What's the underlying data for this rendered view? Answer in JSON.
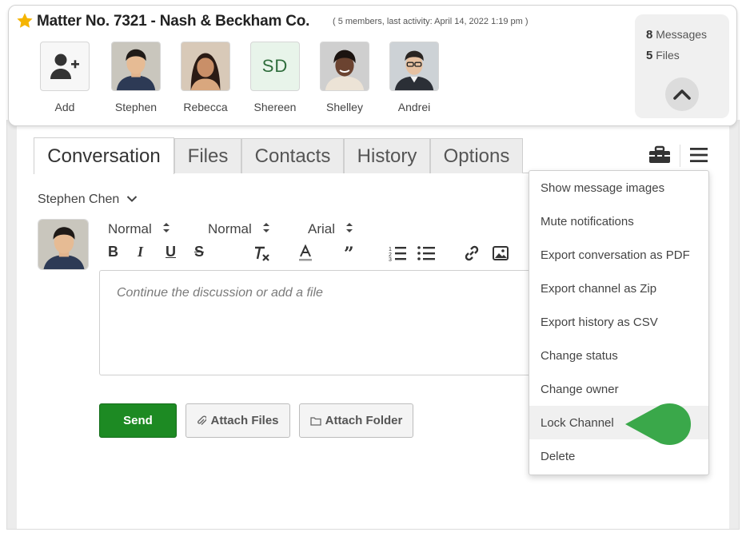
{
  "header": {
    "title": "Matter No. 7321 - Nash & Beckham Co.",
    "subtitle": "( 5 members, last activity: April 14, 2022 1:19 pm )",
    "members": [
      {
        "name": "Add",
        "kind": "add",
        "icon": "add-user-icon"
      },
      {
        "name": "Stephen",
        "kind": "photo"
      },
      {
        "name": "Rebecca",
        "kind": "photo"
      },
      {
        "name": "Shereen",
        "kind": "initials",
        "initials": "SD"
      },
      {
        "name": "Shelley",
        "kind": "photo"
      },
      {
        "name": "Andrei",
        "kind": "photo"
      }
    ],
    "stats": {
      "messages_count": "8",
      "messages_label": "Messages",
      "files_count": "5",
      "files_label": "Files"
    }
  },
  "tabs": [
    {
      "label": "Conversation",
      "active": true
    },
    {
      "label": "Files",
      "active": false
    },
    {
      "label": "Contacts",
      "active": false
    },
    {
      "label": "History",
      "active": false
    },
    {
      "label": "Options",
      "active": false
    }
  ],
  "composer": {
    "author": "Stephen Chen",
    "format": {
      "style": "Normal",
      "size": "Normal",
      "font": "Arial"
    },
    "placeholder": "Continue the discussion or add a file",
    "send_label": "Send",
    "attach_files_label": "Attach Files",
    "attach_folder_label": "Attach Folder"
  },
  "menu": {
    "items": [
      "Show message images",
      "Mute notifications",
      "Export conversation as PDF",
      "Export channel as Zip",
      "Export history as CSV",
      "Change status",
      "Change owner",
      "Lock Channel",
      "Delete"
    ],
    "highlighted": "Lock Channel"
  },
  "colors": {
    "accent_green": "#1d8a23",
    "pointer_green": "#3aa84a",
    "star": "#f5b400",
    "initials_bg": "#e8f4ea"
  }
}
